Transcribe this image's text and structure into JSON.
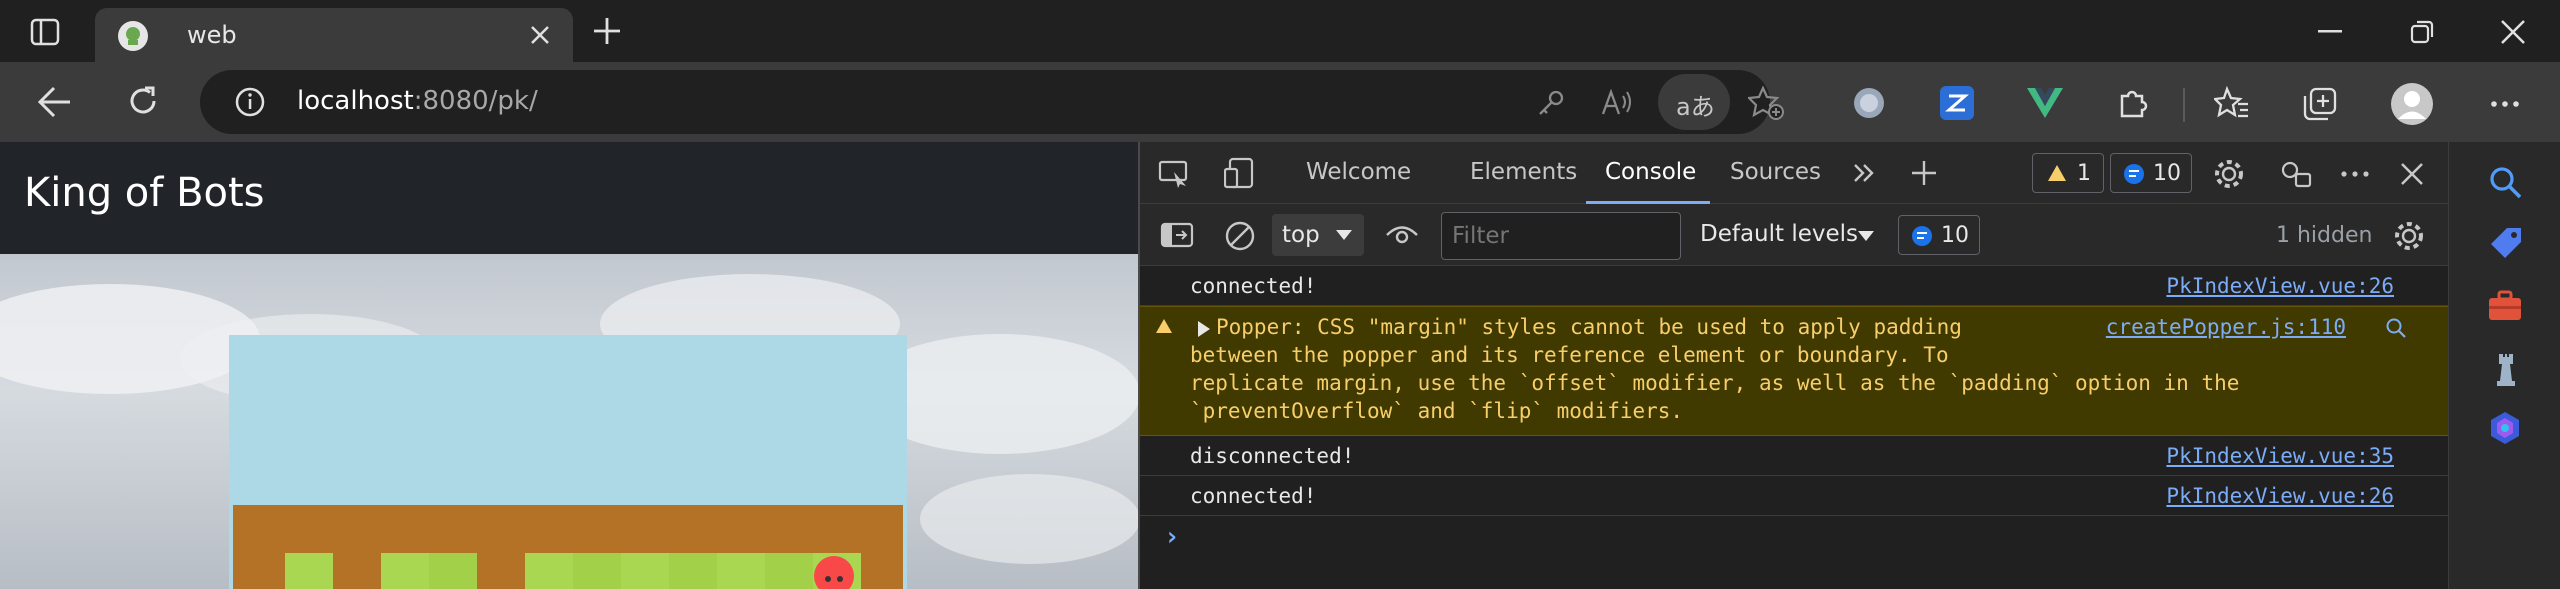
{
  "browser": {
    "tab_title": "web",
    "new_tab_symbol": "+",
    "url_host": "localhost",
    "url_path": ":8080/pk/"
  },
  "page": {
    "brand": "King of Bots"
  },
  "devtools": {
    "tabs": [
      "Welcome",
      "Elements",
      "Console",
      "Sources"
    ],
    "warning_count": "1",
    "message_count": "10",
    "context": "top",
    "filter_placeholder": "Filter",
    "levels": "Default levels",
    "toolbar_message_count": "10",
    "hidden": "1 hidden",
    "messages": [
      {
        "text": "connected!",
        "source": "PkIndexView.vue:26"
      },
      {
        "lines": [
          "Popper: CSS \"margin\" styles cannot be used to apply padding",
          "between the popper and its reference element or boundary. To",
          "replicate margin, use the `offset` modifier, as well as the `padding` option in the",
          "`preventOverflow` and `flip` modifiers."
        ],
        "source": "createPopper.js:110"
      },
      {
        "text": "disconnected!",
        "source": "PkIndexView.vue:35"
      },
      {
        "text": "connected!",
        "source": "PkIndexView.vue:26"
      }
    ],
    "prompt": "›"
  },
  "colors": {
    "accent": "#7cacf8",
    "warning_bg": "#413a00",
    "warning_text": "#f8ce6b",
    "board": "#b37226",
    "playground": "#add8e6",
    "grass_light": "#aad751",
    "grass_dark": "#a2d149",
    "snake": "#f94848"
  }
}
